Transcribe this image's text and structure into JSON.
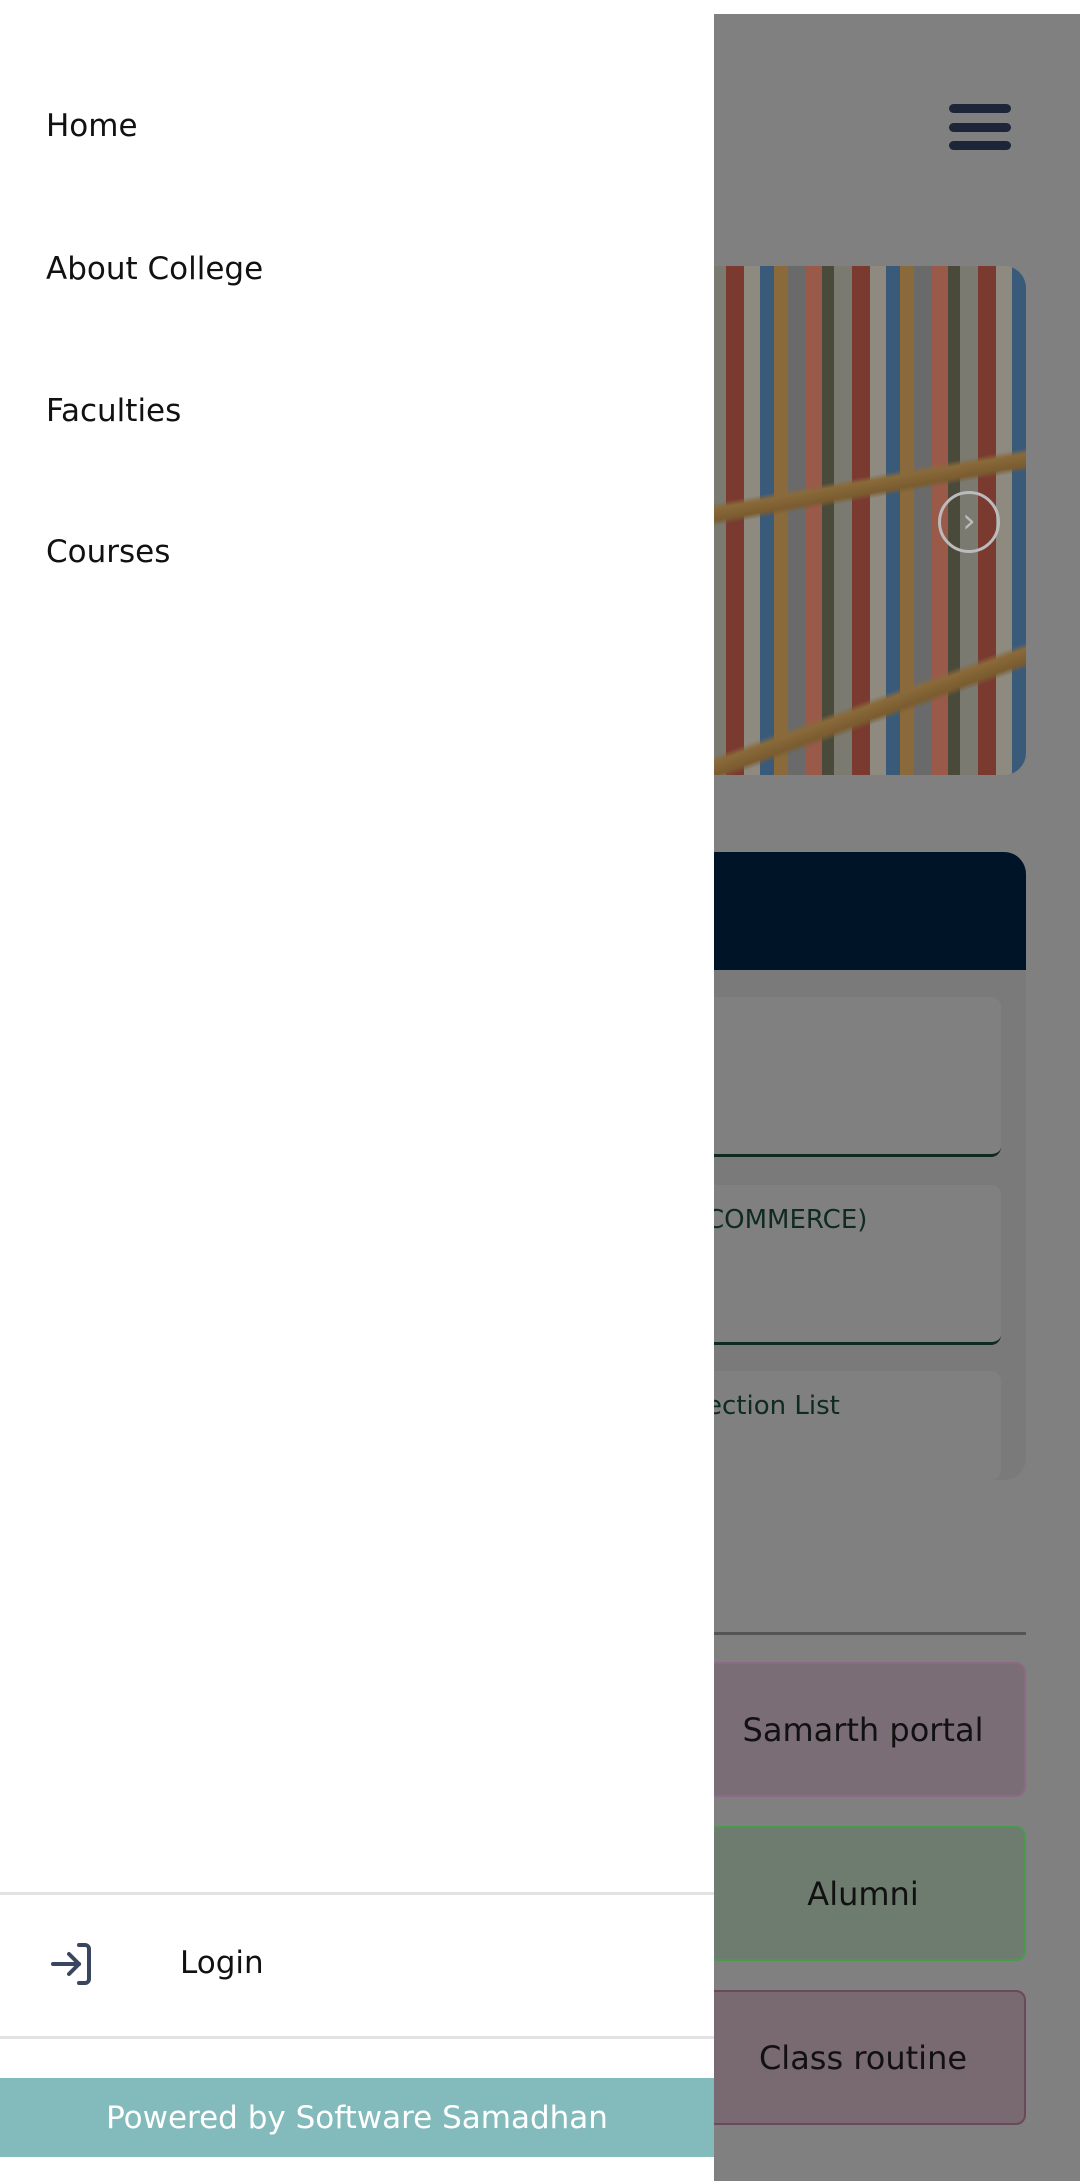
{
  "drawer": {
    "nav_items": [
      {
        "label": "Home"
      },
      {
        "label": "About College"
      },
      {
        "label": "Faculties"
      },
      {
        "label": "Courses"
      }
    ],
    "login_label": "Login",
    "login_icon": "login-icon",
    "footer": "Powered by Software Samadhan",
    "footer_color": "#83bbbc"
  },
  "background": {
    "menu_icon": "hamburger-icon",
    "carousel_next_icon": "chevron-right-circle-icon",
    "card_items": [
      {
        "label": ""
      },
      {
        "label": "COMMERCE)"
      },
      {
        "label": "ection List"
      }
    ],
    "tiles": [
      {
        "label": "Samarth portal"
      },
      {
        "label": "Alumni"
      },
      {
        "label": "Class routine"
      }
    ]
  }
}
